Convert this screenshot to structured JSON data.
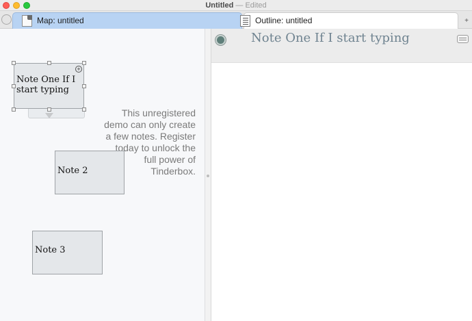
{
  "window": {
    "title": "Untitled",
    "separator": "—",
    "state": "Edited"
  },
  "tabs": [
    {
      "label": "Map: untitled",
      "selected": true
    },
    {
      "label": "Outline: untitled",
      "selected": false
    }
  ],
  "tabbar": {
    "add_glyph": "+"
  },
  "map": {
    "notes": [
      {
        "title": "Note One If I start typing",
        "selected": true
      },
      {
        "title": "Note 2"
      },
      {
        "title": "Note 3"
      }
    ],
    "expand_glyph": "+",
    "demo_message": "This unregistered demo can only create a few notes. Register today to unlock the full power of Tinderbox."
  },
  "outline": {
    "title": "Note One If I start typing"
  },
  "colors": {
    "selected_tab": "#b8d3f3",
    "note_fill": "#e4e7ea",
    "outline_title": "#6f8390",
    "bullet": "#5f7f7a"
  },
  "icons": [
    "map-document-icon",
    "outline-document-icon",
    "expand-note-icon",
    "outline-bullet-icon",
    "table-view-icon",
    "drag-arrow-icon"
  ]
}
